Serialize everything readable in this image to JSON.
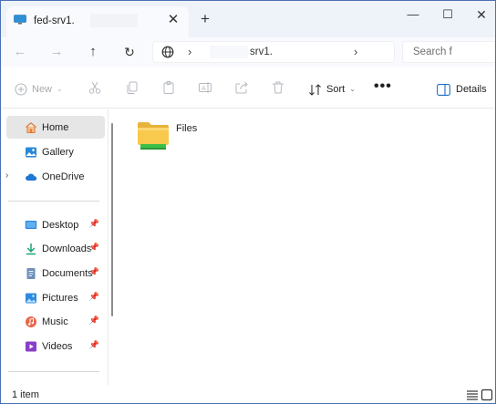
{
  "window": {
    "tab_title": "fed-srv1.",
    "tab_close": "✕",
    "new_tab": "+",
    "minimize": "—",
    "maximize": "☐",
    "close": "✕"
  },
  "nav": {
    "back": "←",
    "forward": "→",
    "up": "↑",
    "refresh": "↻",
    "path_segment": "srv1.",
    "search_placeholder": "Search f"
  },
  "commands": {
    "new_label": "New",
    "sort_label": "Sort",
    "more_label": "•••",
    "details_label": "Details"
  },
  "sidebar": {
    "top_items": [
      {
        "label": "Home",
        "icon": "home-icon",
        "selected": true
      },
      {
        "label": "Gallery",
        "icon": "gallery-icon"
      },
      {
        "label": "OneDrive",
        "icon": "onedrive-icon",
        "expandable": true
      }
    ],
    "pinned_items": [
      {
        "label": "Desktop",
        "icon": "desktop-icon"
      },
      {
        "label": "Downloads",
        "icon": "downloads-icon"
      },
      {
        "label": "Documents",
        "icon": "documents-icon"
      },
      {
        "label": "Pictures",
        "icon": "pictures-icon"
      },
      {
        "label": "Music",
        "icon": "music-icon"
      },
      {
        "label": "Videos",
        "icon": "videos-icon"
      }
    ]
  },
  "content": {
    "items": [
      {
        "label": "Files",
        "icon": "network-folder-icon"
      }
    ]
  },
  "status": {
    "item_count": "1 item"
  },
  "colors": {
    "accent": "#0067c0",
    "folder": "#f8c94c",
    "selection": "#e6e6e6",
    "border": "#4a6fb5"
  }
}
